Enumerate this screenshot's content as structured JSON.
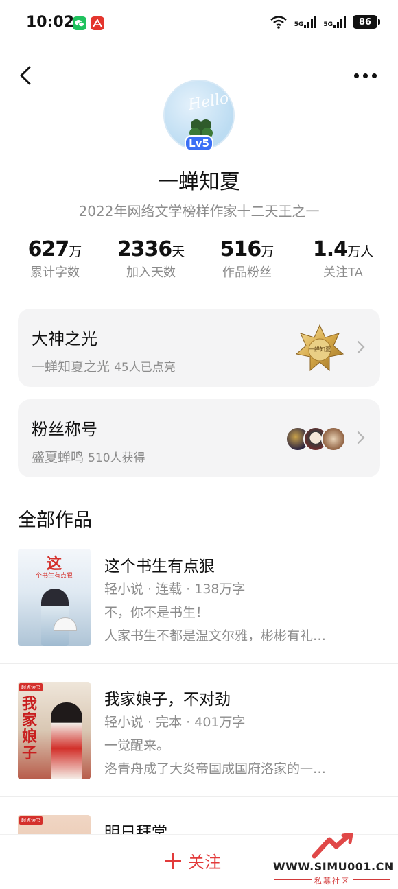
{
  "status_bar": {
    "time": "10:02",
    "network_1": "5G",
    "network_2": "5G",
    "battery": "86"
  },
  "nav": {
    "back_icon": "chevron-left-icon",
    "more_icon": "more-horizontal-icon"
  },
  "profile": {
    "avatar_text": "Hello",
    "level": "Lv5",
    "name": "一蝉知夏",
    "honor": "2022年网络文学榜样作家十二天王之一"
  },
  "stats": [
    {
      "value": "627",
      "unit": "万",
      "label": "累计字数"
    },
    {
      "value": "2336",
      "unit": "天",
      "label": "加入天数"
    },
    {
      "value": "516",
      "unit": "万",
      "label": "作品粉丝"
    },
    {
      "value": "1.4",
      "unit": "万人",
      "label": "关注TA"
    }
  ],
  "cards": {
    "light": {
      "title": "大神之光",
      "subtitle": "一蝉知夏之光",
      "count": "45人已点亮",
      "medal_text": "一蝉知夏"
    },
    "fan_title": {
      "title": "粉丝称号",
      "subtitle": "盛夏蝉鸣",
      "count": "510人获得"
    }
  },
  "works": {
    "section_title": "全部作品",
    "items": [
      {
        "title": "这个书生有点狠",
        "meta": "轻小说 · 连载 · 138万字",
        "desc1": "不，你不是书生！",
        "desc2": "人家书生不都是温文尔雅，彬彬有礼…",
        "cover_big": "这",
        "cover_small": "个书生有点狠"
      },
      {
        "title": "我家娘子，不对劲",
        "meta": "轻小说 · 完本 · 401万字",
        "desc1": "一觉醒来。",
        "desc2": "洛青舟成了大炎帝国成国府洛家的一…",
        "cover_badge": "起点读书",
        "cover_big": "我家娘子"
      },
      {
        "title": "明日拜堂",
        "cover_badge": "起点读书"
      }
    ]
  },
  "bottom_bar": {
    "follow_label": "关注"
  },
  "watermark": {
    "url": "WWW.SIMU001.CN",
    "sub": "私募社区"
  },
  "colors": {
    "accent_red": "#e23a3a",
    "level_blue": "#3b6ff5",
    "card_bg": "#f4f4f5",
    "secondary_text": "#8c8c8c"
  }
}
